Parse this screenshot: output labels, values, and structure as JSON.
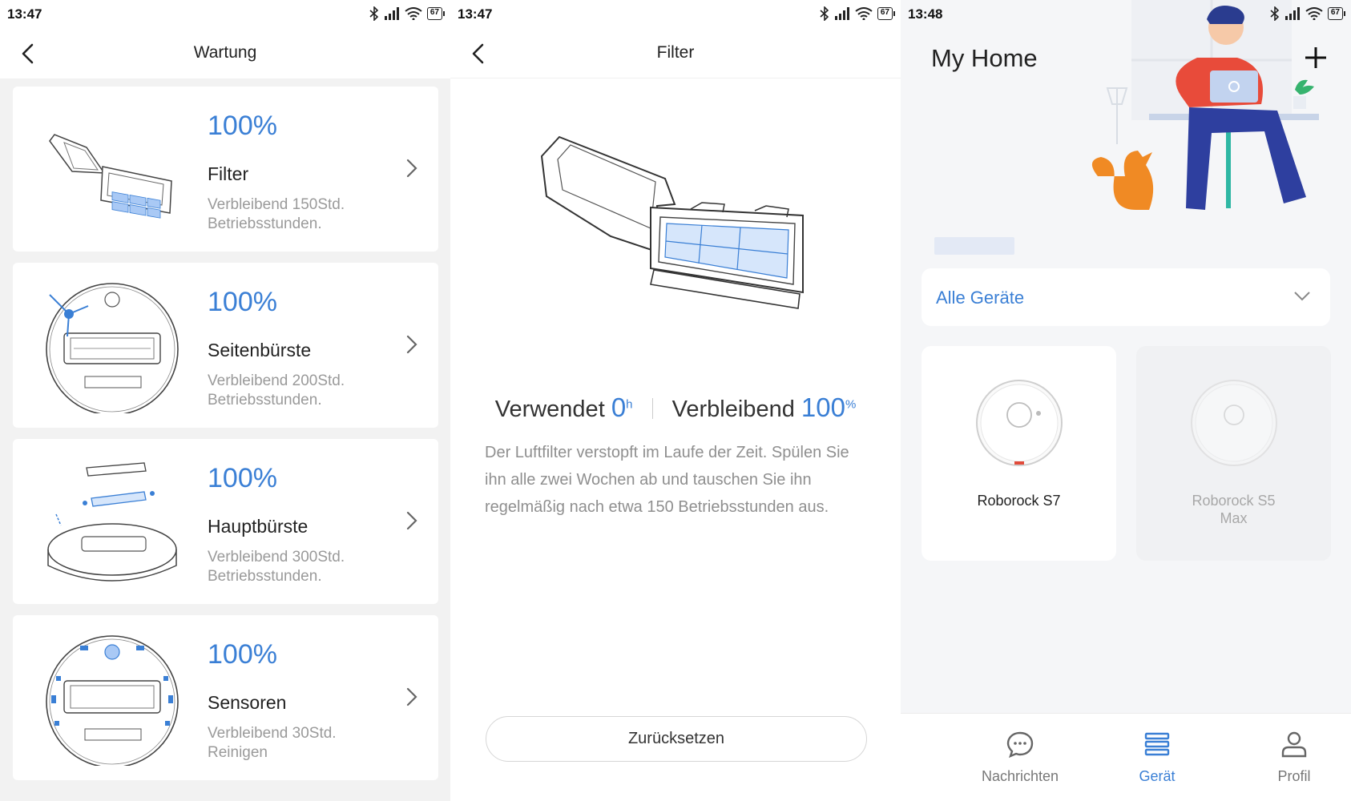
{
  "colors": {
    "accent": "#3a7fd5",
    "text": "#222222",
    "muted": "#9a9a9a"
  },
  "panel_maintenance": {
    "status_time": "13:47",
    "battery": "67",
    "title": "Wartung",
    "items": [
      {
        "percent": "100%",
        "name": "Filter",
        "remaining_line1": "Verbleibend 150Std.",
        "remaining_line2": "Betriebsstunden.",
        "icon": "filter-box-icon"
      },
      {
        "percent": "100%",
        "name": "Seitenbürste",
        "remaining_line1": "Verbleibend 200Std.",
        "remaining_line2": "Betriebsstunden.",
        "icon": "side-brush-icon"
      },
      {
        "percent": "100%",
        "name": "Hauptbürste",
        "remaining_line1": "Verbleibend 300Std.",
        "remaining_line2": "Betriebsstunden.",
        "icon": "main-brush-icon"
      },
      {
        "percent": "100%",
        "name": "Sensoren",
        "remaining_line1": "Verbleibend 30Std.",
        "remaining_line2": "Reinigen",
        "icon": "sensors-icon"
      }
    ]
  },
  "panel_filter": {
    "status_time": "13:47",
    "battery": "67",
    "title": "Filter",
    "used_label": "Verwendet",
    "used_value": "0",
    "used_unit": "h",
    "remaining_label": "Verbleibend",
    "remaining_value": "100",
    "remaining_unit": "%",
    "description": "Der Luftfilter verstopft im Laufe der Zeit. Spülen Sie ihn alle zwei Wochen ab und tauschen Sie ihn regelmäßig nach etwa 150 Betriebsstunden aus.",
    "reset_label": "Zurücksetzen"
  },
  "panel_home": {
    "status_time": "13:48",
    "battery": "67",
    "title": "My Home",
    "dropdown_label": "Alle Geräte",
    "devices": [
      {
        "name": "Roborock S7",
        "active": true
      },
      {
        "name": "Roborock S5 Max",
        "active": false
      }
    ],
    "tabs": [
      {
        "label": "Nachrichten",
        "icon": "chat-icon"
      },
      {
        "label": "Gerät",
        "icon": "device-list-icon",
        "active": true
      },
      {
        "label": "Profil",
        "icon": "person-icon"
      }
    ]
  }
}
